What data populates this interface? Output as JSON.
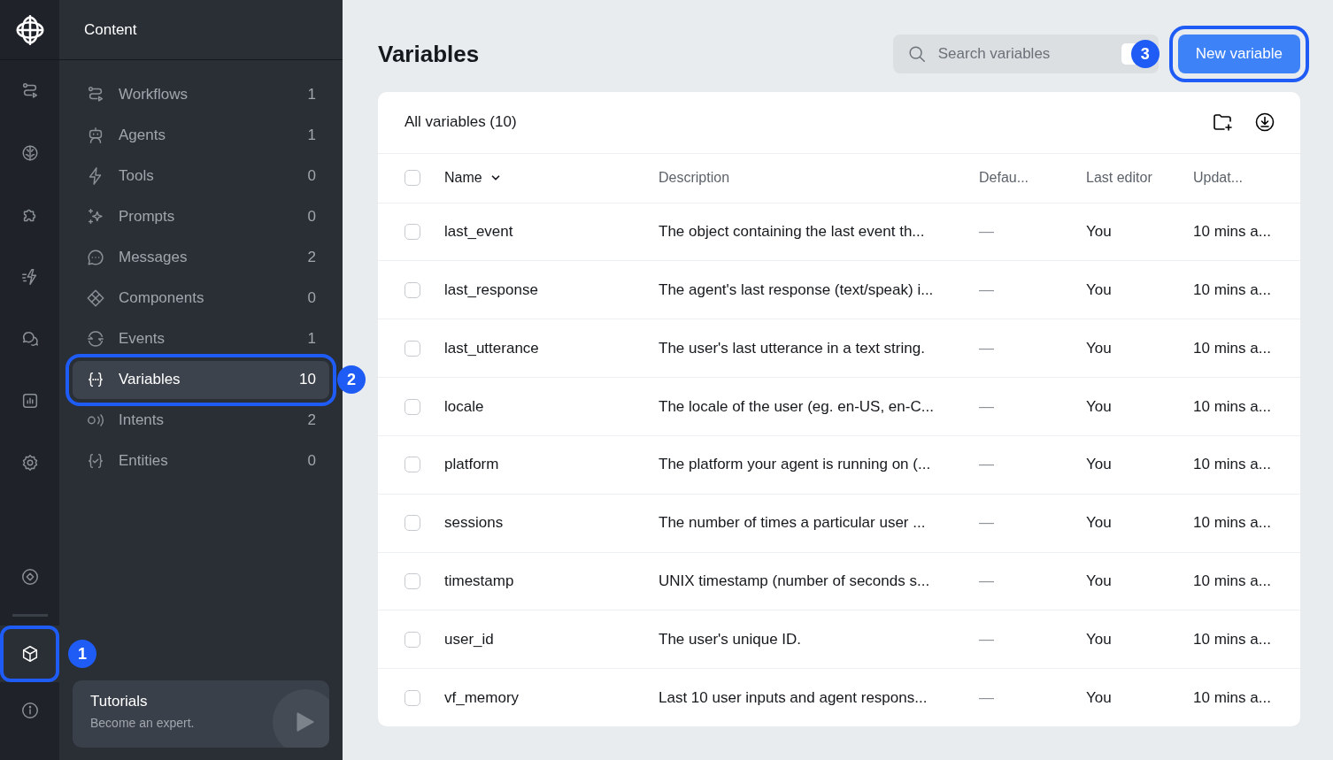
{
  "rail": {
    "items": [
      {
        "selected": false
      },
      {
        "selected": false
      },
      {
        "selected": false
      },
      {
        "selected": false
      },
      {
        "selected": false
      },
      {
        "selected": false
      },
      {
        "selected": false
      }
    ],
    "bottom_items": [
      {
        "selected": false
      },
      {
        "selected": true,
        "callout": "1"
      },
      {
        "selected": false
      }
    ]
  },
  "sidebar": {
    "title": "Content",
    "items": [
      {
        "label": "Workflows",
        "count": "1",
        "selected": false
      },
      {
        "label": "Agents",
        "count": "1",
        "selected": false
      },
      {
        "label": "Tools",
        "count": "0",
        "selected": false
      },
      {
        "label": "Prompts",
        "count": "0",
        "selected": false
      },
      {
        "label": "Messages",
        "count": "2",
        "selected": false
      },
      {
        "label": "Components",
        "count": "0",
        "selected": false
      },
      {
        "label": "Events",
        "count": "1",
        "selected": false
      },
      {
        "label": "Variables",
        "count": "10",
        "selected": true,
        "callout": "2"
      },
      {
        "label": "Intents",
        "count": "2",
        "selected": false
      },
      {
        "label": "Entities",
        "count": "0",
        "selected": false
      }
    ],
    "tutorial": {
      "title": "Tutorials",
      "subtitle": "Become an expert."
    }
  },
  "page": {
    "title": "Variables",
    "search": {
      "placeholder": "Search variables"
    },
    "new_button": {
      "label": "New variable",
      "callout": "3"
    }
  },
  "table": {
    "title": "All variables (10)",
    "select_all_checked": false,
    "columns": [
      {
        "label": "Name",
        "sorted": true
      },
      {
        "label": "Description",
        "sorted": false
      },
      {
        "label": "Defau...",
        "sorted": false
      },
      {
        "label": "Last editor",
        "sorted": false
      },
      {
        "label": "Updat...",
        "sorted": false
      }
    ],
    "rows": [
      {
        "name": "last_event",
        "description": "The object containing the last event th...",
        "default": "—",
        "last_editor": "You",
        "updated": "10 mins a...",
        "checked": false
      },
      {
        "name": "last_response",
        "description": "The agent's last response (text/speak) i...",
        "default": "—",
        "last_editor": "You",
        "updated": "10 mins a...",
        "checked": false
      },
      {
        "name": "last_utterance",
        "description": "The user's last utterance in a text string.",
        "default": "—",
        "last_editor": "You",
        "updated": "10 mins a...",
        "checked": false
      },
      {
        "name": "locale",
        "description": "The locale of the user (eg. en-US, en-C...",
        "default": "—",
        "last_editor": "You",
        "updated": "10 mins a...",
        "checked": false
      },
      {
        "name": "platform",
        "description": "The platform your agent is running on (...",
        "default": "—",
        "last_editor": "You",
        "updated": "10 mins a...",
        "checked": false
      },
      {
        "name": "sessions",
        "description": "The number of times a particular user ...",
        "default": "—",
        "last_editor": "You",
        "updated": "10 mins a...",
        "checked": false
      },
      {
        "name": "timestamp",
        "description": "UNIX timestamp (number of seconds s...",
        "default": "—",
        "last_editor": "You",
        "updated": "10 mins a...",
        "checked": false
      },
      {
        "name": "user_id",
        "description": "The user's unique ID.",
        "default": "—",
        "last_editor": "You",
        "updated": "10 mins a...",
        "checked": false
      },
      {
        "name": "vf_memory",
        "description": "Last 10 user inputs and agent respons...",
        "default": "—",
        "last_editor": "You",
        "updated": "10 mins a...",
        "checked": false
      }
    ]
  }
}
